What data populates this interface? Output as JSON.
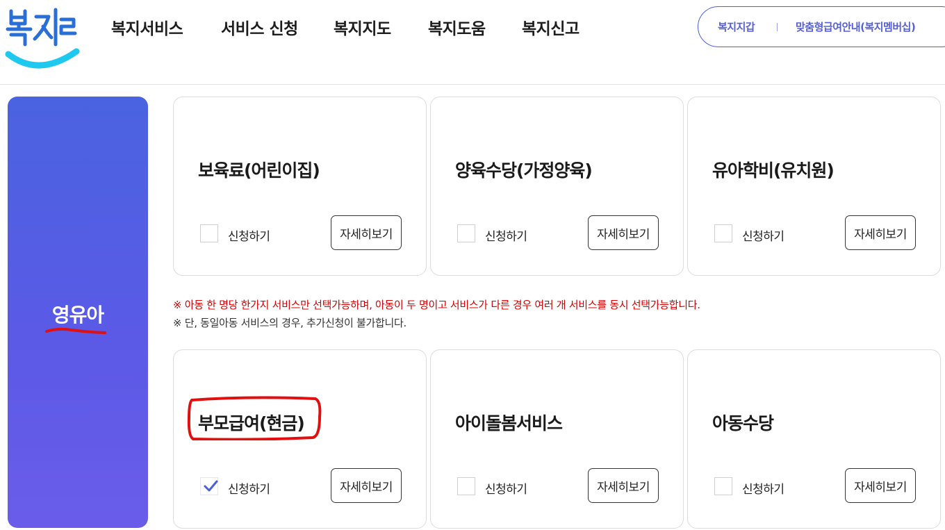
{
  "logo": {
    "text": "복지로",
    "icon": "bokjiro-logo"
  },
  "nav": {
    "items": [
      "복지서비스",
      "서비스 신청",
      "복지지도",
      "복지도움",
      "복지신고"
    ]
  },
  "util": {
    "wallet": "복지지갑",
    "membership": "맞춤형급여안내(복지멤버십)"
  },
  "sidebar": {
    "category": "영유아"
  },
  "cards_top": [
    {
      "title": "보육료(어린이집)",
      "apply_label": "신청하기",
      "checked": false,
      "detail_label": "자세히보기"
    },
    {
      "title": "양육수당(가정양육)",
      "apply_label": "신청하기",
      "checked": false,
      "detail_label": "자세히보기"
    },
    {
      "title": "유아학비(유치원)",
      "apply_label": "신청하기",
      "checked": false,
      "detail_label": "자세히보기"
    }
  ],
  "notices": {
    "line1": "※ 아동 한 명당 한가지 서비스만 선택가능하며, 아동이 두 명이고 서비스가 다른 경우 여러 개 서비스를 동시 선택가능합니다.",
    "line2": "※ 단, 동일아동 서비스의 경우, 추가신청이 불가합니다."
  },
  "cards_bottom": [
    {
      "title": "부모급여(현금)",
      "apply_label": "신청하기",
      "checked": true,
      "detail_label": "자세히보기"
    },
    {
      "title": "아이돌봄서비스",
      "apply_label": "신청하기",
      "checked": false,
      "detail_label": "자세히보기"
    },
    {
      "title": "아동수당",
      "apply_label": "신청하기",
      "checked": false,
      "detail_label": "자세히보기"
    }
  ],
  "colors": {
    "accent": "#4a5fd9",
    "notice_red": "#d40000",
    "annotation_red": "#e01010",
    "logo_sky": "#1ec8ee",
    "logo_blue": "#2a6fd6"
  }
}
